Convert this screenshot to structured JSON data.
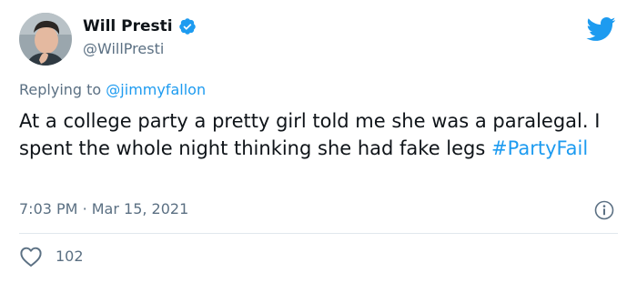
{
  "author": {
    "display_name": "Will Presti",
    "handle": "@WillPresti",
    "verified": true
  },
  "reply": {
    "prefix": "Replying to",
    "mention": "@jimmyfallon"
  },
  "tweet": {
    "text": "At a college party a pretty girl told me she was a paralegal. I spent the whole night thinking she had fake legs",
    "hashtag": "#PartyFail"
  },
  "meta": {
    "time": "7:03 PM",
    "separator": "·",
    "date": "Mar 15, 2021"
  },
  "engagement": {
    "likes": "102"
  },
  "icons": {
    "brand": "twitter-bird-icon",
    "verified": "verified-badge-icon",
    "info": "info-icon",
    "like": "heart-icon"
  },
  "colors": {
    "accent": "#1d9bf0",
    "secondary_text": "#5b7083",
    "primary_text": "#0f1419",
    "divider": "#e1e8ed"
  }
}
